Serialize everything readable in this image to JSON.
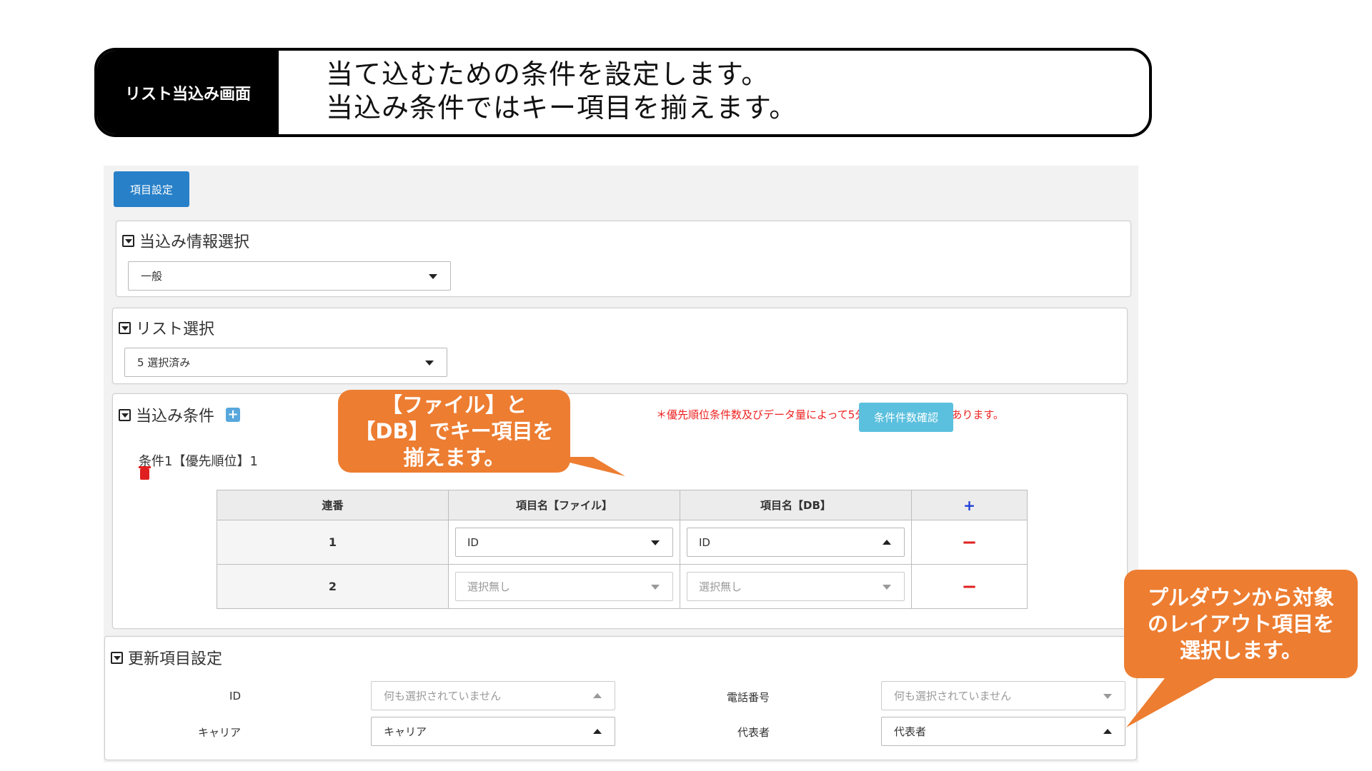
{
  "banner": {
    "label": "リスト当込み画面",
    "line1": "当て込むための条件を設定します。",
    "line2": "当込み条件ではキー項目を揃えます。"
  },
  "toolbar": {
    "item_settings_button": "項目設定"
  },
  "panel_info": {
    "title": "当込み情報選択",
    "select_value": "一般"
  },
  "panel_list": {
    "title": "リスト選択",
    "select_value": "5 選択済み"
  },
  "panel_condition": {
    "title": "当込み条件",
    "add_symbol": "+",
    "warning": "＊優先順位条件数及びデータ量によって5分以上かかる場合があります。",
    "check_button": "条件件数確認",
    "condition_label": "条件1【優先順位】1",
    "table": {
      "headers": [
        "連番",
        "項目名【ファイル】",
        "項目名【DB】",
        "+"
      ],
      "rows": [
        {
          "no": "1",
          "file": "ID",
          "db": "ID",
          "remove": "−"
        },
        {
          "no": "2",
          "file": "選択無し",
          "db": "選択無し",
          "remove": "−"
        }
      ]
    }
  },
  "panel_update": {
    "title": "更新項目設定",
    "fields": [
      {
        "label": "ID",
        "value": "何も選択されていません"
      },
      {
        "label": "電話番号",
        "value": "何も選択されていません"
      },
      {
        "label": "キャリア",
        "value": "キャリア"
      },
      {
        "label": "代表者",
        "value": "代表者"
      }
    ]
  },
  "callouts": {
    "key_items": [
      "【ファイル】と",
      "【DB】でキー項目を",
      "揃えます。"
    ],
    "pulldown": [
      "プルダウンから対象",
      "のレイアウト項目を",
      "選択します。"
    ]
  },
  "colors": {
    "primary_button": "#2780c8",
    "info_button": "#5bc0de",
    "callout": "#ed7d31",
    "warning_text": "#ee2222",
    "remove_icon": "#e02020",
    "add_icon": "#1f3fd6"
  }
}
